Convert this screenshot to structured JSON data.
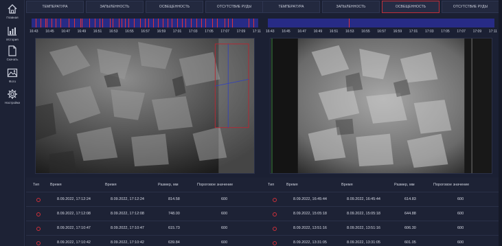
{
  "sidebar": {
    "items": [
      {
        "label": "Главная",
        "icon": "home-icon"
      },
      {
        "label": "История",
        "icon": "chart-icon"
      },
      {
        "label": "Скачать",
        "icon": "file-icon"
      },
      {
        "label": "Фото",
        "icon": "image-icon"
      },
      {
        "label": "Настройки",
        "icon": "gear-icon"
      }
    ]
  },
  "panels": [
    {
      "tabs": [
        "ТЕМПЕРАТУРА",
        "ЗАПЫЛЕННОСТЬ",
        "ОСВЕЩЕННОСТЬ",
        "ОТСУТСТВИЕ РУДЫ"
      ],
      "active_tab": 3,
      "times": [
        "16:43",
        "16:45",
        "16:47",
        "16:49",
        "16:51",
        "16:53",
        "16:55",
        "16:57",
        "16:59",
        "17:01",
        "17:03",
        "17:05",
        "17:07",
        "17:09",
        "17:11"
      ],
      "table": {
        "headers": {
          "type": "Тип",
          "time1": "Время",
          "time2": "Время",
          "size": "Размер, мм",
          "threshold": "Пороговое значение"
        },
        "rows": [
          {
            "t1": "8.09.2022, 17:12:24",
            "t2": "8.09.2022, 17:12:24",
            "size": "814.58",
            "thr": "600"
          },
          {
            "t1": "8.09.2022, 17:12:08",
            "t2": "8.09.2022, 17:12:08",
            "size": "748.00",
            "thr": "600"
          },
          {
            "t1": "8.09.2022, 17:10:47",
            "t2": "8.09.2022, 17:10:47",
            "size": "615.73",
            "thr": "600"
          },
          {
            "t1": "8.09.2022, 17:10:42",
            "t2": "8.09.2022, 17:10:42",
            "size": "639.84",
            "thr": "600"
          }
        ]
      }
    },
    {
      "tabs": [
        "ТЕМПЕРАТУРА",
        "ЗАПЫЛЕННОСТЬ",
        "ОСВЕЩЕННОСТЬ",
        "ОТСУТСТВИЕ РУДЫ"
      ],
      "active_tab": 2,
      "times": [
        "16:43",
        "16:45",
        "16:47",
        "16:49",
        "16:51",
        "16:53",
        "16:55",
        "16:57",
        "16:59",
        "17:01",
        "17:03",
        "17:05",
        "17:07",
        "17:09",
        "17:11"
      ],
      "table": {
        "headers": {
          "type": "Тип",
          "time1": "Время",
          "time2": "Время",
          "size": "Размер, мм",
          "threshold": "Пороговое значение"
        },
        "rows": [
          {
            "t1": "8.09.2022, 16:45:44",
            "t2": "8.09.2022, 16:45:44",
            "size": "614.83",
            "thr": "600"
          },
          {
            "t1": "8.09.2022, 15:05:18",
            "t2": "8.09.2022, 15:05:18",
            "size": "644.88",
            "thr": "600"
          },
          {
            "t1": "8.09.2022, 13:51:16",
            "t2": "8.09.2022, 13:51:16",
            "size": "606.30",
            "thr": "600"
          },
          {
            "t1": "8.09.2022, 13:31:05",
            "t2": "8.09.2022, 13:31:05",
            "size": "601.05",
            "thr": "600"
          }
        ]
      }
    }
  ]
}
